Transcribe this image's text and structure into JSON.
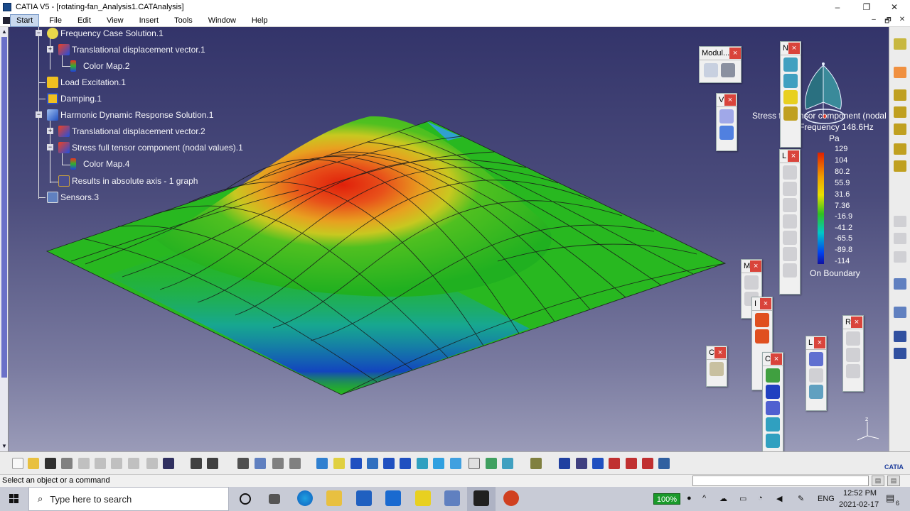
{
  "window": {
    "title": "CATIA V5 - [rotating-fan_Analysis1.CATAnalysis]",
    "controls": {
      "minimize": "–",
      "restore": "❐",
      "close": "✕"
    }
  },
  "menu": {
    "items": [
      "Start",
      "File",
      "Edit",
      "View",
      "Insert",
      "Tools",
      "Window",
      "Help"
    ],
    "mdi_controls": [
      "–",
      "🗗",
      "✕"
    ]
  },
  "tree": {
    "nodes": [
      {
        "label": "Frequency Case Solution.1",
        "icon": "solution-icon",
        "color": "#e8d84a"
      },
      {
        "label": "Translational displacement vector.1",
        "icon": "displacement-icon",
        "color": "#f04020"
      },
      {
        "label": "Color Map.2",
        "icon": "color-map-icon",
        "color": "#2040e0"
      },
      {
        "label": "Load Excitation.1",
        "icon": "load-icon",
        "color": "#f0c020"
      },
      {
        "label": "Damping.1",
        "icon": "damping-icon",
        "color": "#f0c020"
      },
      {
        "label": "Harmonic Dynamic Response Solution.1",
        "icon": "harmonic-icon",
        "color": "#3070d0"
      },
      {
        "label": "Translational displacement vector.2",
        "icon": "displacement-icon",
        "color": "#f04020"
      },
      {
        "label": "Stress full tensor component (nodal values).1",
        "icon": "stress-icon",
        "color": "#f04020"
      },
      {
        "label": "Color Map.4",
        "icon": "color-map-icon",
        "color": "#2040e0"
      },
      {
        "label": "Results in absolute axis - 1 graph",
        "icon": "graph-icon",
        "color": "#4a4e90"
      },
      {
        "label": "Sensors.3",
        "icon": "sensors-icon",
        "color": "#6080c0"
      }
    ]
  },
  "legend": {
    "title_line1": "Stress full tensor component (nodal v",
    "title_line2": "Frequency 148.6Hz",
    "unit": "Pa",
    "values": [
      "129",
      "104",
      "80.2",
      "55.9",
      "31.6",
      "7.36",
      "-16.9",
      "-41.2",
      "-65.5",
      "-89.8",
      "-114"
    ],
    "footer": "On Boundary"
  },
  "floating_toolbars": {
    "modul": {
      "title": "Modul...",
      "close": "×"
    },
    "v": {
      "title": "V",
      "close": "×"
    },
    "n1": {
      "title": "N",
      "close": "×"
    },
    "l1": {
      "title": "L",
      "close": "×"
    },
    "m2": {
      "title": "M",
      "close": "×"
    },
    "i2": {
      "title": "I",
      "close": "×"
    },
    "c1": {
      "title": "C",
      "close": "×"
    },
    "c2": {
      "title": "C",
      "close": "×"
    },
    "l2": {
      "title": "L",
      "close": "×"
    },
    "r": {
      "title": "R",
      "close": "×"
    }
  },
  "status": {
    "text": "Select an object or a command"
  },
  "taskbar": {
    "search_placeholder": "Type here to search",
    "zoom": "100%",
    "lang": "ENG",
    "time": "12:52 PM",
    "date": "2021-02-17",
    "notification_count": "6",
    "catia_logo": "CATIA"
  },
  "colors": {
    "viewport_top": "#33346a",
    "viewport_bottom": "#9a9bb8",
    "accent_close": "#d9443b"
  }
}
